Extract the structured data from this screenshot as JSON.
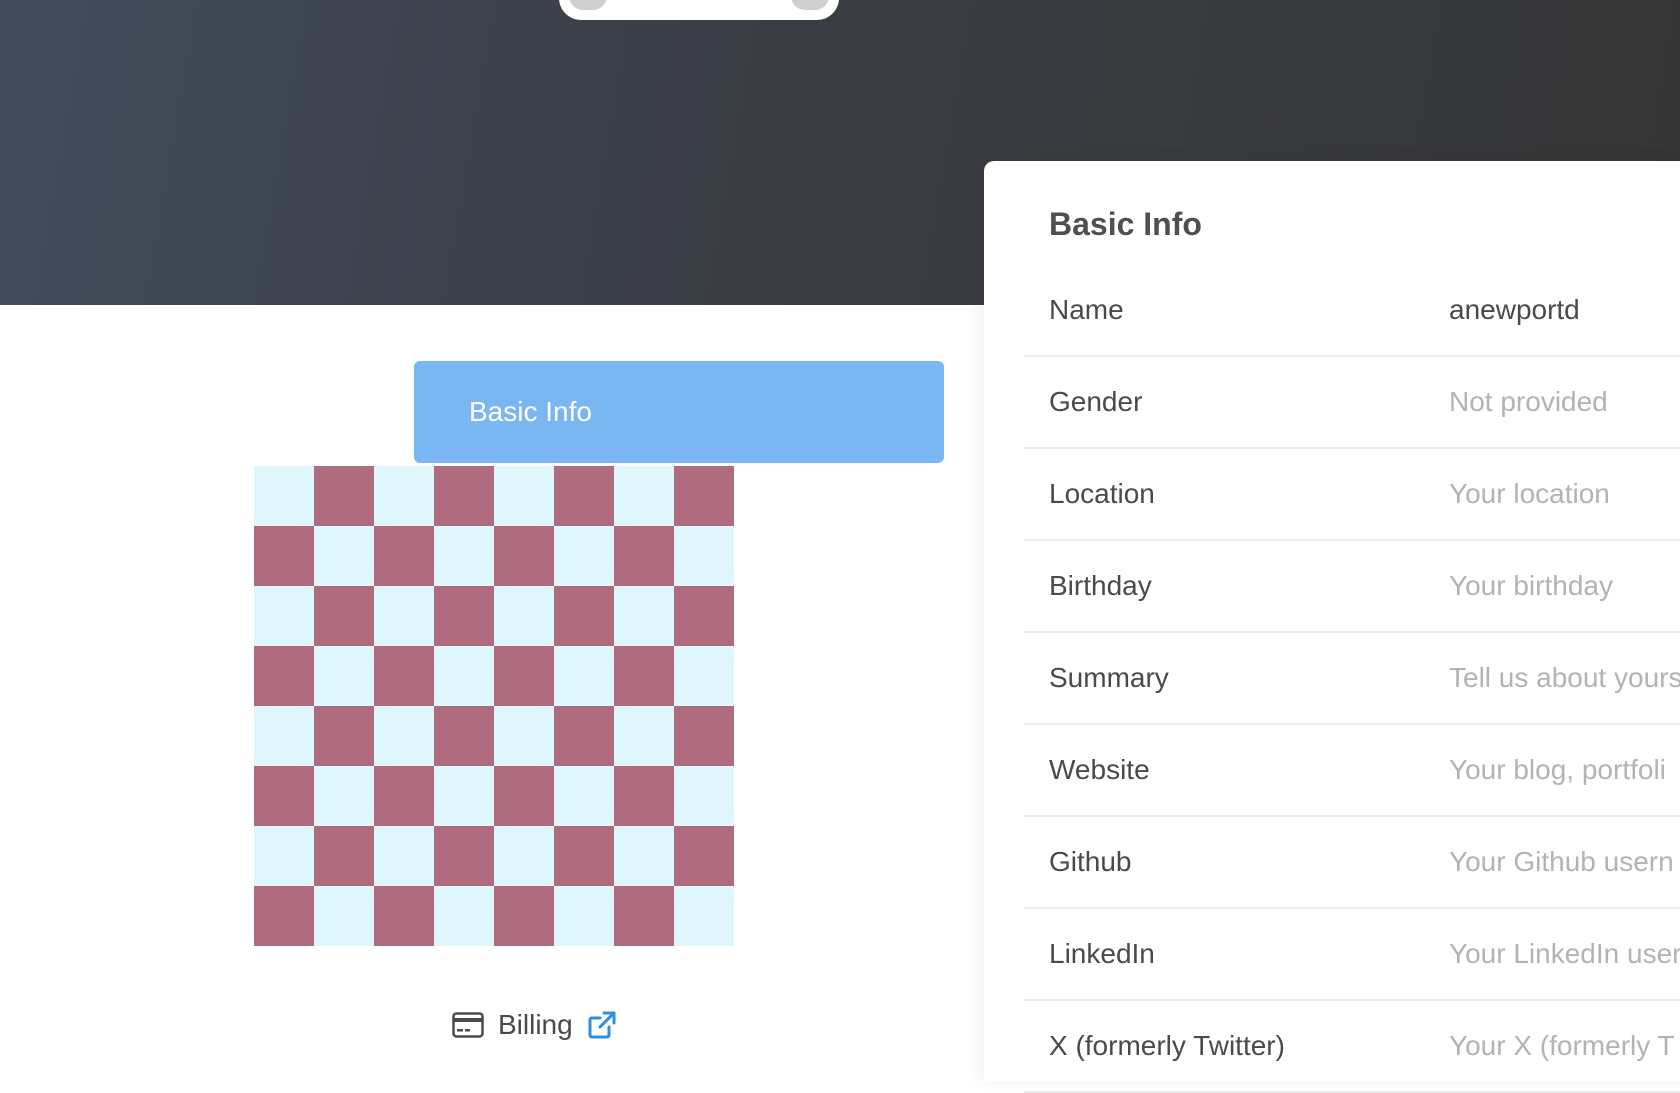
{
  "menu": {
    "active_label": "Basic Info"
  },
  "billing": {
    "label": "Billing",
    "icon": "credit-card-icon",
    "external_icon": "external-link-icon",
    "icon_color": "#2f8fd8"
  },
  "avatar": {
    "colors": [
      "#dff6fd",
      "#ae6c7e"
    ]
  },
  "panel": {
    "title": "Basic Info",
    "rows": [
      {
        "label": "Name",
        "value": "anewportd",
        "placeholder": false
      },
      {
        "label": "Gender",
        "value": "Not provided",
        "placeholder": true
      },
      {
        "label": "Location",
        "value": "Your location",
        "placeholder": true
      },
      {
        "label": "Birthday",
        "value": "Your birthday",
        "placeholder": true
      },
      {
        "label": "Summary",
        "value": "Tell us about yours",
        "placeholder": true
      },
      {
        "label": "Website",
        "value": "Your blog, portfoli",
        "placeholder": true
      },
      {
        "label": "Github",
        "value": "Your Github usern",
        "placeholder": true
      },
      {
        "label": "LinkedIn",
        "value": "Your LinkedIn user",
        "placeholder": true
      },
      {
        "label": "X (formerly Twitter)",
        "value": "Your X (formerly T",
        "placeholder": true
      }
    ]
  }
}
